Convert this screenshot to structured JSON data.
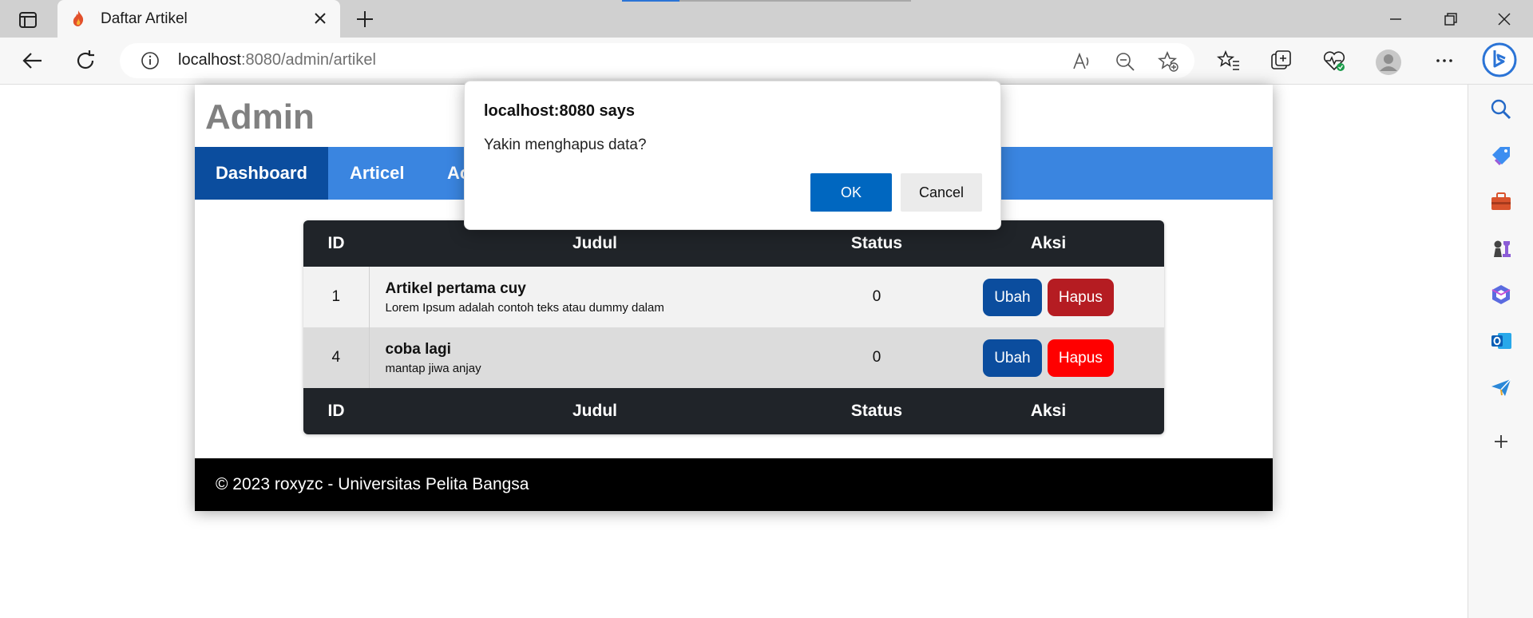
{
  "browser": {
    "tab_title": "Daftar Artikel",
    "url_host": "localhost",
    "url_rest": ":8080/admin/artikel"
  },
  "site": {
    "brand": "Admin",
    "menu": [
      {
        "label": "Dashboard",
        "active": true
      },
      {
        "label": "Articel",
        "active": false
      },
      {
        "label": "Ac",
        "active": false
      }
    ],
    "table": {
      "headers": [
        "ID",
        "Judul",
        "Status",
        "Aksi"
      ],
      "rows": [
        {
          "id": "1",
          "title": "Artikel pertama cuy",
          "desc": "Lorem Ipsum adalah contoh teks atau dummy dalam",
          "status": "0",
          "edit": "Ubah",
          "delete": "Hapus"
        },
        {
          "id": "4",
          "title": "coba lagi",
          "desc": "mantap jiwa anjay",
          "status": "0",
          "edit": "Ubah",
          "delete": "Hapus"
        }
      ]
    },
    "footer": "© 2023 roxyzc - Universitas Pelita Bangsa"
  },
  "dialog": {
    "title": "localhost:8080 says",
    "message": "Yakin menghapus data?",
    "ok": "OK",
    "cancel": "Cancel"
  },
  "colors": {
    "menu_bg": "#3a85e0",
    "menu_active": "#0b4d9e",
    "table_head": "#202429",
    "delete_red": "#ff0000",
    "dialog_ok": "#0067c0"
  }
}
